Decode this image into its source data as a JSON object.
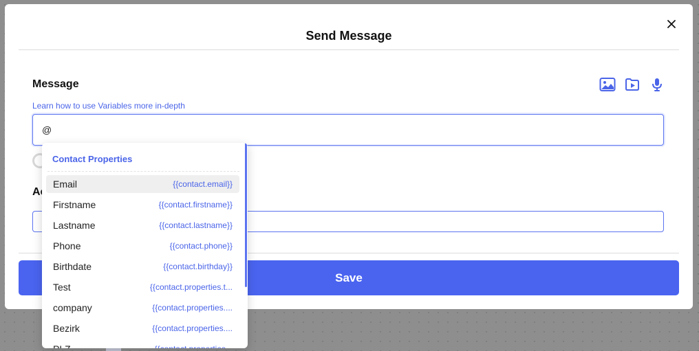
{
  "modal": {
    "title": "Send Message",
    "message_label": "Message",
    "help_link": "Learn how to use Variables more in-depth",
    "input_value": "@",
    "second_label": "Ac",
    "save_label": "Save"
  },
  "media_icons": [
    "image-icon",
    "video-icon",
    "microphone-icon"
  ],
  "dropdown": {
    "header": "Contact Properties",
    "items": [
      {
        "name": "Email",
        "variable": "{{contact.email}}"
      },
      {
        "name": "Firstname",
        "variable": "{{contact.firstname}}"
      },
      {
        "name": "Lastname",
        "variable": "{{contact.lastname}}"
      },
      {
        "name": "Phone",
        "variable": "{{contact.phone}}"
      },
      {
        "name": "Birthdate",
        "variable": "{{contact.birthday}}"
      },
      {
        "name": "Test",
        "variable": "{{contact.properties.t..."
      },
      {
        "name": "company",
        "variable": "{{contact.properties...."
      },
      {
        "name": "Bezirk",
        "variable": "{{contact.properties...."
      },
      {
        "name": "PLZ",
        "variable": "{{contact.properties..."
      }
    ]
  },
  "colors": {
    "accent": "#4a64f0",
    "link": "#4a64e8",
    "overlay": "#8e8e8e"
  }
}
